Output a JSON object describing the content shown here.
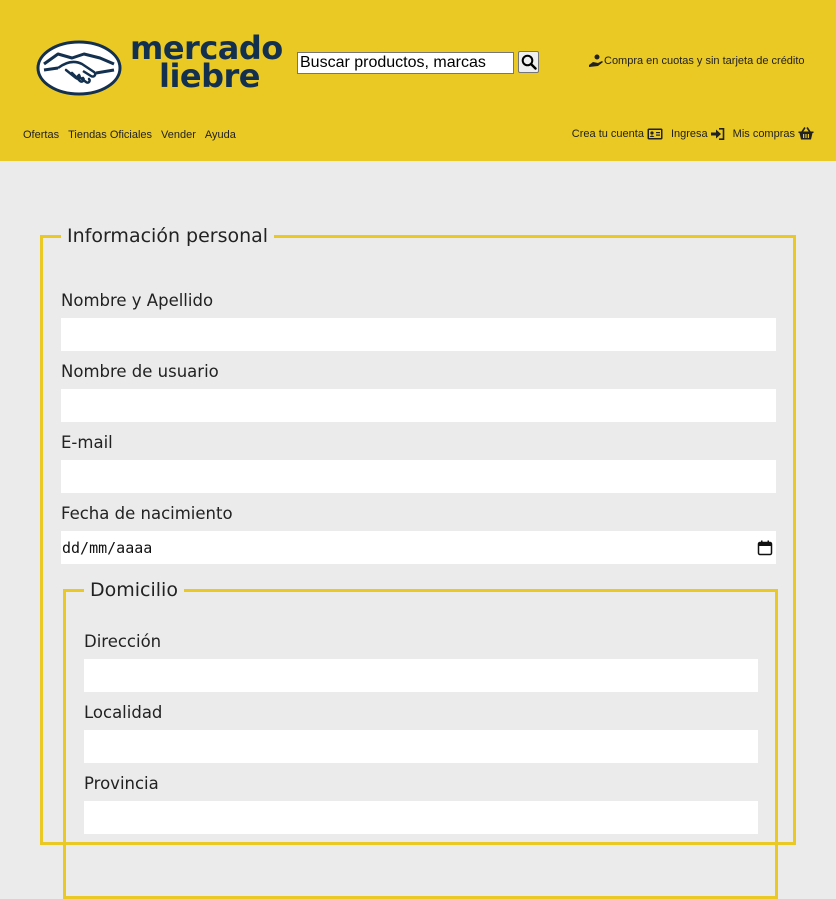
{
  "brand": {
    "logo_line1": "mercado",
    "logo_line2": "liebre",
    "primary_color": "#ebc924",
    "logo_text_color": "#13304f"
  },
  "search": {
    "placeholder": "Buscar productos, marcas",
    "button_icon": "search-icon"
  },
  "promo": {
    "icon": "hand-coin-icon",
    "text": "Compra en cuotas y sin tarjeta de crédito"
  },
  "nav_left": [
    {
      "label": "Ofertas"
    },
    {
      "label": "Tiendas Oficiales"
    },
    {
      "label": "Vender"
    },
    {
      "label": "Ayuda"
    }
  ],
  "nav_right": [
    {
      "label": "Crea tu cuenta",
      "icon": "id-card-icon"
    },
    {
      "label": "Ingresa",
      "icon": "sign-in-icon"
    },
    {
      "label": "Mis compras",
      "icon": "shopping-basket-icon"
    }
  ],
  "form": {
    "personal_legend": "Información personal",
    "fields": [
      {
        "label": "Nombre y Apellido",
        "value": ""
      },
      {
        "label": "Nombre de usuario",
        "value": ""
      },
      {
        "label": "E-mail",
        "value": ""
      },
      {
        "label": "Fecha de nacimiento",
        "value": "dd/mm/aaaa"
      }
    ],
    "domicilio_legend": "Domicilio",
    "domicilio_fields": [
      {
        "label": "Dirección",
        "value": ""
      },
      {
        "label": "Localidad",
        "value": ""
      },
      {
        "label": "Provincia",
        "value": ""
      }
    ]
  }
}
